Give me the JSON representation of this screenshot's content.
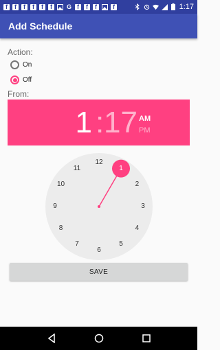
{
  "status_bar": {
    "time": "1:17",
    "notification_icons": [
      "f",
      "f",
      "f",
      "f",
      "f",
      "f",
      "image",
      "G",
      "f",
      "f",
      "f",
      "image",
      "f"
    ],
    "right_icons": [
      "bluetooth-icon",
      "alarm-icon",
      "wifi-icon",
      "signal-icon",
      "battery-icon"
    ]
  },
  "app_bar": {
    "title": "Add Schedule"
  },
  "action": {
    "label": "Action:",
    "options": [
      {
        "label": "On",
        "checked": false
      },
      {
        "label": "Off",
        "checked": true
      }
    ]
  },
  "from": {
    "label": "From:",
    "hour": "1",
    "colon": ":",
    "minute": "17",
    "am_label": "AM",
    "pm_label": "PM",
    "selected_period": "AM"
  },
  "clock": {
    "selected_hour": 1,
    "numbers": [
      "12",
      "1",
      "2",
      "3",
      "4",
      "5",
      "6",
      "7",
      "8",
      "9",
      "10",
      "11"
    ],
    "accent_color": "#ff4081",
    "face_color": "#ececec"
  },
  "save_label": "SAVE",
  "colors": {
    "status_bar": "#303f9f",
    "app_bar": "#3f51b5",
    "accent": "#ff4081"
  },
  "nav_bar": {
    "icons": [
      "back-icon",
      "home-icon",
      "recents-icon"
    ]
  }
}
